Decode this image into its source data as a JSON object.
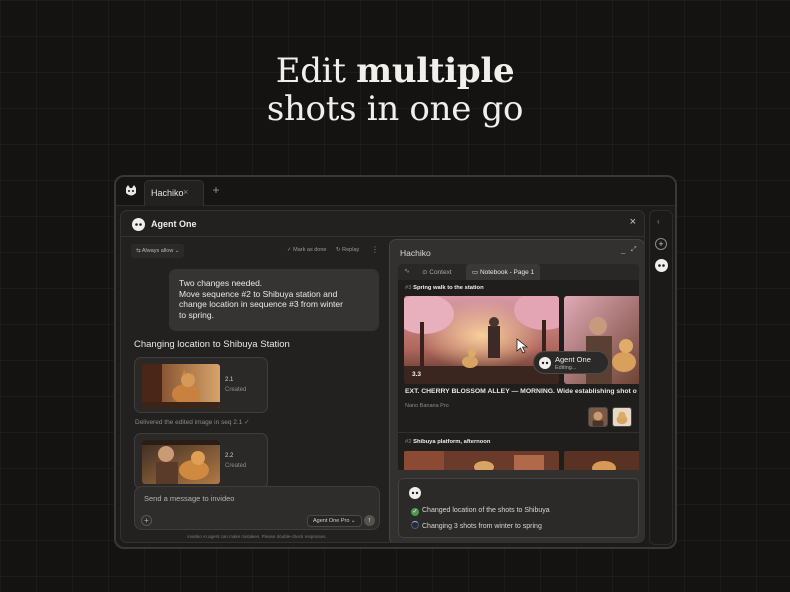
{
  "headline": {
    "line1_regular": "Edit ",
    "line1_bold": "multiple",
    "line2": "shots in one go"
  },
  "window": {
    "tab_label": "Hachiko",
    "tab_close": "×",
    "tab_add": "+"
  },
  "agent_panel": {
    "title": "Agent One",
    "close": "×",
    "toolbar": {
      "always_allow": "⇆ Always allow ⌄",
      "mark_done": "✓ Mark as done",
      "replay": "↻ Replay",
      "more": "⋮"
    },
    "user_message": [
      "Two changes needed.",
      "Move sequence #2 to Shibuya station and",
      "change location in sequence #3 from winter",
      "to spring."
    ],
    "section_title": "Changing location to Shibuya Station",
    "shots": [
      {
        "num": "2.1",
        "status": "Created"
      },
      {
        "num": "2.2",
        "status": "Created"
      }
    ],
    "delivered": "Delivered the edited image in seq 2.1",
    "delivered_check": "✓",
    "composer": {
      "placeholder": "Send a message to invideo",
      "add": "+",
      "model": "Agent One Pro ⌄",
      "send": "↑"
    },
    "disclaimer": "invideo AI agent can make mistakes. Please double-check responses."
  },
  "editor": {
    "title": "Hachiko",
    "minimize": "_",
    "maximize": "⤢",
    "tabs": {
      "activity_icon": "∿",
      "context": "⊙ Context",
      "notebook": "▭ Notebook - Page 1"
    },
    "seq3": {
      "hash": "#3",
      "name": "Spring walk to the station"
    },
    "shot_badge": "3.3",
    "agent_tag": {
      "name": "Agent One",
      "status": "Editing..."
    },
    "caption": "EXT. CHERRY BLOSSOM ALLEY — MORNING. Wide establishing shot of the alley",
    "model": "Nano Banana Pro",
    "seq2": {
      "hash": "#2",
      "name": "Shibuya platform, afternoon"
    },
    "progress": [
      {
        "text": "Changed location of the shots to Shibuya",
        "state": "done"
      },
      {
        "text": "Changing 3 shots from winter to spring",
        "state": "running"
      }
    ]
  },
  "rail": {
    "collapse": "‹",
    "add": "+"
  },
  "colors": {
    "background": "#151312",
    "panel": "#222120",
    "editor": "#333130",
    "success": "#4a9a4e",
    "running": "#8ab4f0"
  }
}
